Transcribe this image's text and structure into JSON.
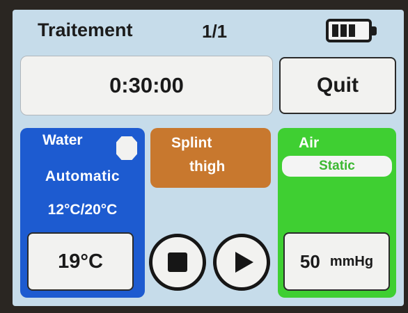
{
  "header": {
    "title": "Traitement",
    "page_indicator": "1/1",
    "battery_icon": "battery-full-icon",
    "battery_level": 1.0
  },
  "timer": {
    "value": "0:30:00"
  },
  "actions": {
    "quit_label": "Quit"
  },
  "water": {
    "label": "Water",
    "mode": "Automatic",
    "range": "12°C/20°C",
    "temperature": "19°C",
    "color": "#1d5bd0"
  },
  "splint": {
    "label": "Splint",
    "value": "thigh",
    "color": "#c8782e"
  },
  "controls": {
    "stop_icon": "stop-icon",
    "play_icon": "play-icon"
  },
  "air": {
    "label": "Air",
    "mode": "Static",
    "pressure_value": "50",
    "pressure_unit": "mmHg",
    "color": "#3fcf32"
  },
  "colors": {
    "screen_background": "#c6dcea"
  }
}
